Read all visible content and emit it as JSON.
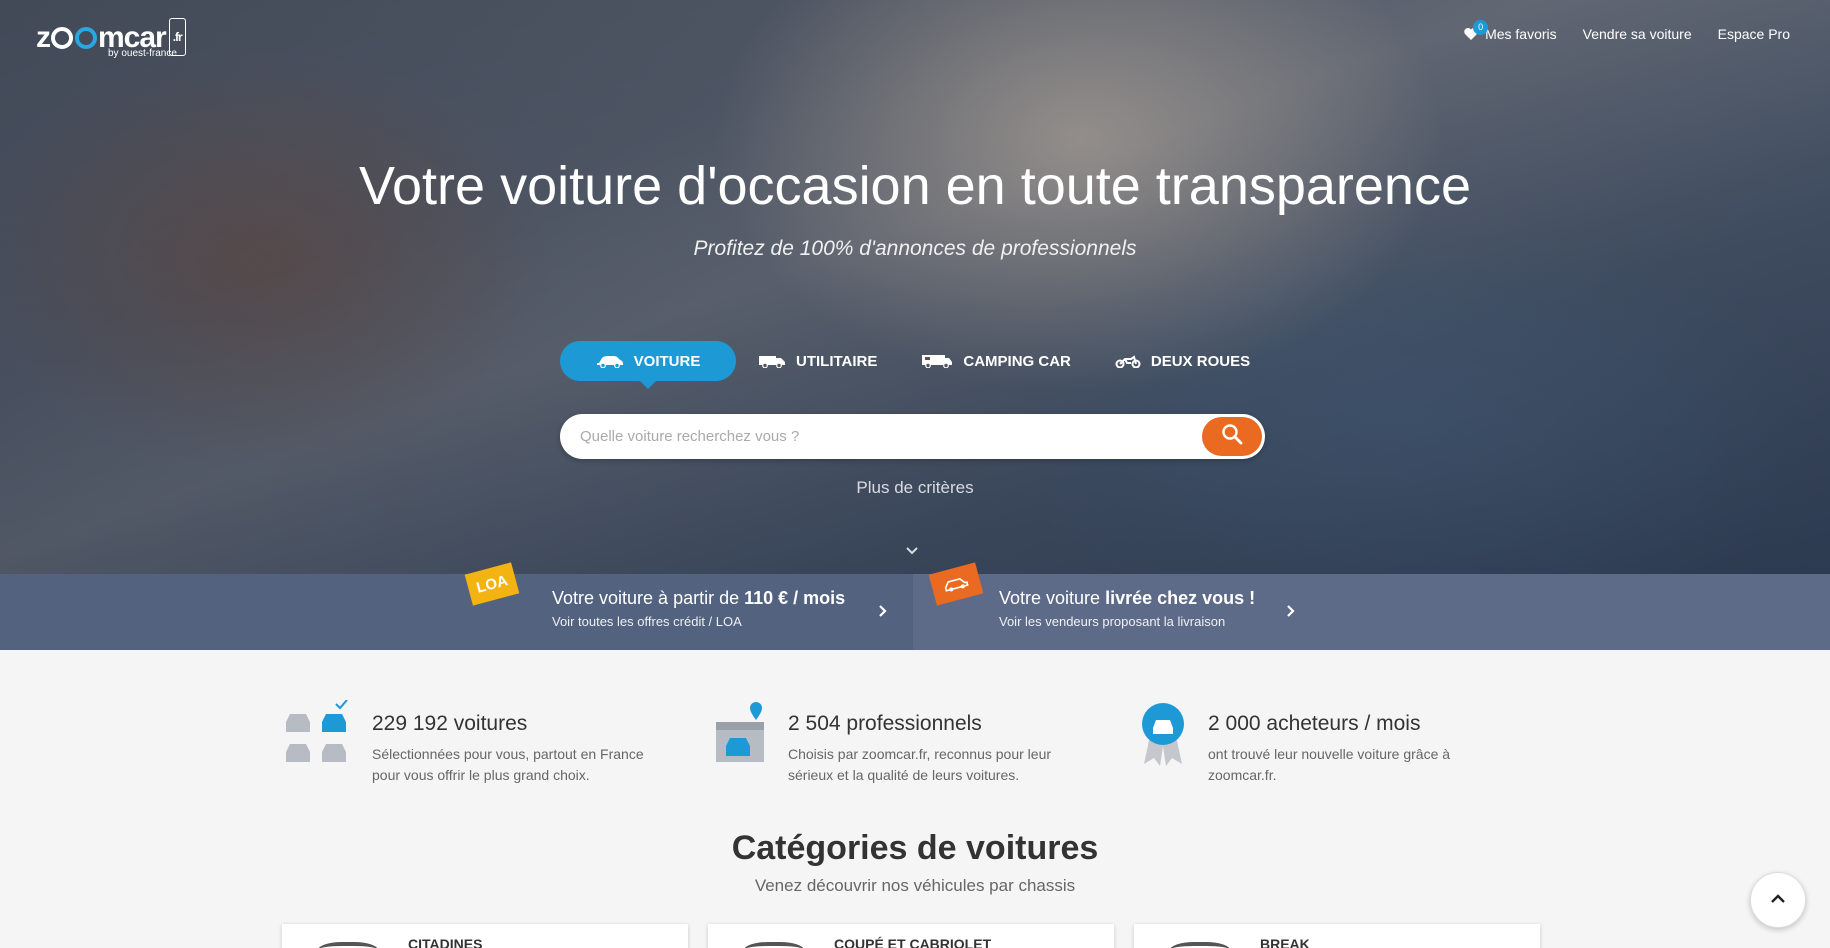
{
  "brand": {
    "logo_text": "zoomcar",
    "logo_tld": ".fr",
    "logo_sub": "by ouest-france",
    "accent": "#1d9ad6",
    "orange": "#ea6a22"
  },
  "nav": {
    "favorites_count": "0",
    "favorites_label": "Mes favoris",
    "sell_label": "Vendre sa voiture",
    "pro_label": "Espace Pro"
  },
  "hero": {
    "title": "Votre voiture d'occasion en toute transparence",
    "subtitle": "Profitez de 100% d'annonces de professionnels"
  },
  "tabs": [
    {
      "label": "VOITURE",
      "icon": "car-icon",
      "active": true
    },
    {
      "label": "UTILITAIRE",
      "icon": "van-icon",
      "active": false
    },
    {
      "label": "CAMPING CAR",
      "icon": "camper-icon",
      "active": false
    },
    {
      "label": "DEUX ROUES",
      "icon": "motorbike-icon",
      "active": false
    }
  ],
  "search": {
    "placeholder": "Quelle voiture recherchez vous ?",
    "button_icon": "search-icon"
  },
  "more_criteria": "Plus de critères",
  "promo": {
    "left": {
      "tag": "LOA",
      "main_prefix": "Votre voiture à partir de ",
      "main_bold": "110 € / mois",
      "sub": "Voir toutes les offres crédit / LOA"
    },
    "right": {
      "tag_icon": "delivery-icon",
      "main_prefix": "Votre voiture ",
      "main_bold": "livrée chez vous !",
      "sub": "Voir les vendeurs proposant la livraison"
    }
  },
  "stats": [
    {
      "icon": "cars-selection-icon",
      "title": "229 192 voitures",
      "desc1": "Sélectionnées pour vous, partout en France",
      "desc2": "pour vous offrir le plus grand choix."
    },
    {
      "icon": "dealership-icon",
      "title": "2 504 professionnels",
      "desc1": "Choisis par zoomcar.fr, reconnus pour leur",
      "desc2": "sérieux et la qualité de leurs voitures."
    },
    {
      "icon": "award-car-icon",
      "title": "2 000 acheteurs / mois",
      "desc1": "ont trouvé leur nouvelle voiture grâce à",
      "desc2": "zoomcar.fr."
    }
  ],
  "categories": {
    "title": "Catégories de voitures",
    "subtitle": "Venez découvrir nos véhicules par chassis",
    "items": [
      "CITADINES",
      "COUPÉ ET CABRIOLET",
      "BREAK"
    ]
  }
}
